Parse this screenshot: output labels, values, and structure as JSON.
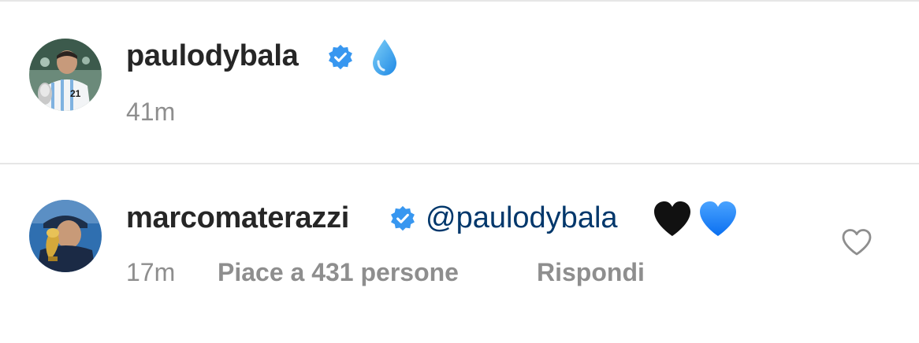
{
  "comments": [
    {
      "username": "paulodybala",
      "verified": true,
      "text_emoji": "droplet",
      "time": "41m",
      "avatar_icon": "profile-photo-paulodybala"
    },
    {
      "username": "marcomaterazzi",
      "verified": true,
      "mention": "@paulodybala",
      "text_emojis": [
        "black-heart",
        "blue-heart"
      ],
      "time": "17m",
      "likes": "Piace a 431 persone",
      "reply": "Rispondi",
      "avatar_icon": "profile-photo-marcomaterazzi"
    }
  ],
  "colors": {
    "verified_blue": "#3897f0",
    "mention_blue": "#00376b",
    "meta_grey": "#8e8e8e",
    "username_dark": "#262626"
  }
}
